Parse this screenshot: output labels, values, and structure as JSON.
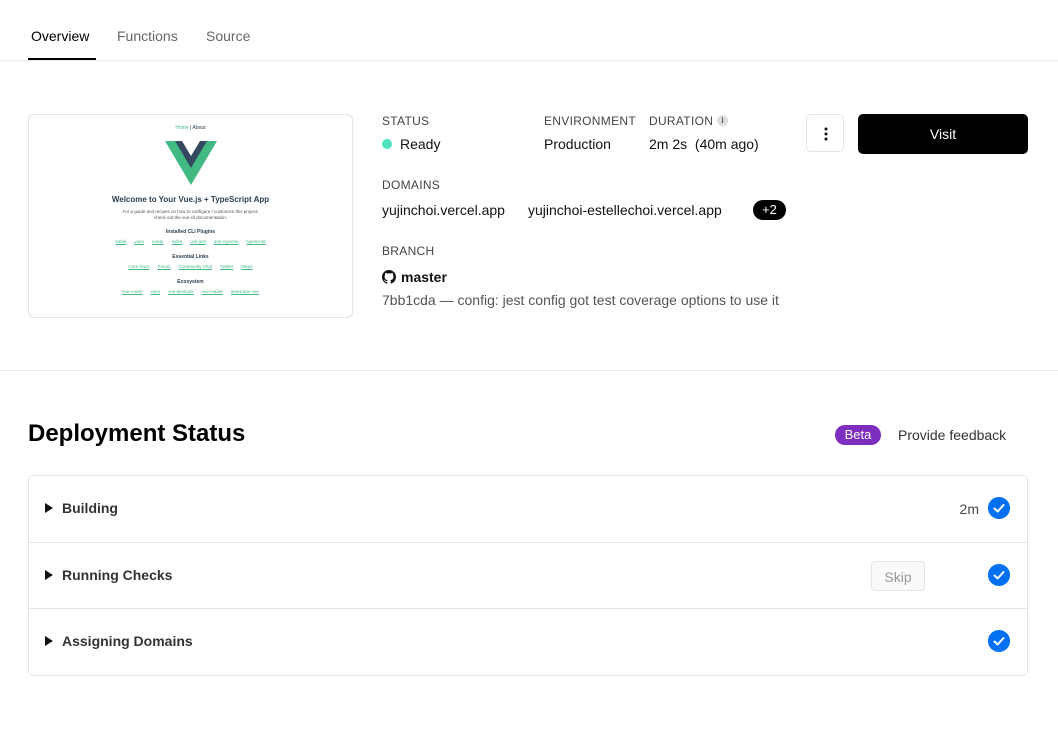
{
  "tabs": [
    {
      "label": "Overview",
      "active": true
    },
    {
      "label": "Functions",
      "active": false
    },
    {
      "label": "Source",
      "active": false
    }
  ],
  "preview": {
    "nav_home": "Home",
    "nav_sep": " | ",
    "nav_about": "About",
    "title": "Welcome to Your Vue.js + TypeScript App",
    "subtitle_line1": "For a guide and recipes on how to configure / customize this project,",
    "subtitle_line2": "check out the vue-cli documentation.",
    "section1": "Installed CLI Plugins",
    "plugins": [
      "babel",
      "vuex",
      "router",
      "eslint",
      "unit-jest",
      "e2e-cypress",
      "typescript"
    ],
    "section2": "Essential Links",
    "links": [
      "Core Docs",
      "Forum",
      "Community Chat",
      "Twitter",
      "News"
    ],
    "section3": "Ecosystem",
    "ecosystem": [
      "vue-router",
      "vuex",
      "vue-devtools",
      "vue-loader",
      "awesome-vue"
    ]
  },
  "details": {
    "status_label": "STATUS",
    "status_value": "Ready",
    "environment_label": "ENVIRONMENT",
    "environment_value": "Production",
    "duration_label": "DURATION",
    "duration_value": "2m 2s",
    "duration_ago": "(40m ago)",
    "info_icon": "i",
    "domains_label": "DOMAINS",
    "domains": [
      "yujinchoi.vercel.app",
      "yujinchoi-estellechoi.vercel.app"
    ],
    "domains_more": "+2",
    "branch_label": "BRANCH",
    "branch_name": "master",
    "commit": "7bb1cda — config: jest config got test coverage options to use it"
  },
  "actions": {
    "visit_label": "Visit",
    "menu_icon": "more-vertical-icon"
  },
  "deployment_status": {
    "title": "Deployment Status",
    "beta_label": "Beta",
    "feedback_label": "Provide feedback",
    "steps": [
      {
        "name": "Building",
        "duration": "2m",
        "skip": ""
      },
      {
        "name": "Running Checks",
        "duration": "",
        "skip": "Skip"
      },
      {
        "name": "Assigning Domains",
        "duration": "",
        "skip": ""
      }
    ]
  },
  "colors": {
    "accent_blue": "#0070f3",
    "status_ready": "#50e3c2",
    "beta_purple": "#7d2ebe",
    "vue_green": "#42b983",
    "vue_dark": "#35495e"
  }
}
